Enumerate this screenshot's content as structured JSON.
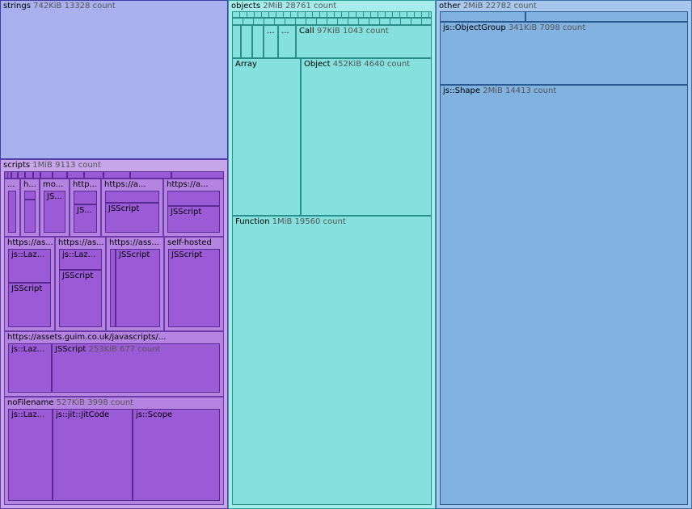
{
  "strings": {
    "name": "strings",
    "size": "742KiB",
    "count": "13328 count"
  },
  "scripts": {
    "name": "scripts",
    "size": "1MiB",
    "count": "9113 count",
    "row1": [
      {
        "label": "...",
        "inner": [
          ""
        ]
      },
      {
        "label": "h...",
        "inner": [
          "",
          ""
        ]
      },
      {
        "label": "mo...",
        "inner": [
          "JS..."
        ]
      },
      {
        "label": "http...",
        "inner": [
          "",
          "JS..."
        ]
      },
      {
        "label": "https://a...",
        "inner": [
          "",
          "JSScript"
        ]
      },
      {
        "label": "https://a...",
        "inner": [
          "",
          "JSScript"
        ]
      }
    ],
    "row2": [
      {
        "label": "https://as...",
        "inner": [
          "js::Laz...",
          "JSScript"
        ]
      },
      {
        "label": "https://as...",
        "inner": [
          "js::Laz...",
          "JSScript"
        ]
      },
      {
        "label": "https://ass...",
        "inner": [
          "",
          "JSScript"
        ]
      },
      {
        "label": "self-hosted",
        "inner": [
          "JSScript"
        ]
      }
    ],
    "guim": {
      "label": "https://assets.guim.co.uk/javascripts/...",
      "laz": "js::Laz...",
      "jsscript": "JSScript",
      "size": "253KiB",
      "count": "677 count"
    },
    "nofilename": {
      "label": "noFilename",
      "size": "527KiB",
      "count": "3998 count",
      "children": [
        "js::Laz...",
        "js::jit::JitCode",
        "js::Scope"
      ]
    }
  },
  "objects": {
    "name": "objects",
    "size": "2MiB",
    "count": "28761 count",
    "dots": [
      "...",
      "..."
    ],
    "call": {
      "name": "Call",
      "size": "97KiB",
      "count": "1043 count"
    },
    "array": {
      "name": "Array"
    },
    "object": {
      "name": "Object",
      "size": "452KiB",
      "count": "4640 count"
    },
    "function": {
      "name": "Function",
      "size": "1MiB",
      "count": "19560 count"
    }
  },
  "other": {
    "name": "other",
    "size": "2MiB",
    "count": "22782 count",
    "objectgroup": {
      "name": "js::ObjectGroup",
      "size": "341KiB",
      "count": "7098 count"
    },
    "shape": {
      "name": "js::Shape",
      "size": "2MiB",
      "count": "14413 count"
    }
  }
}
